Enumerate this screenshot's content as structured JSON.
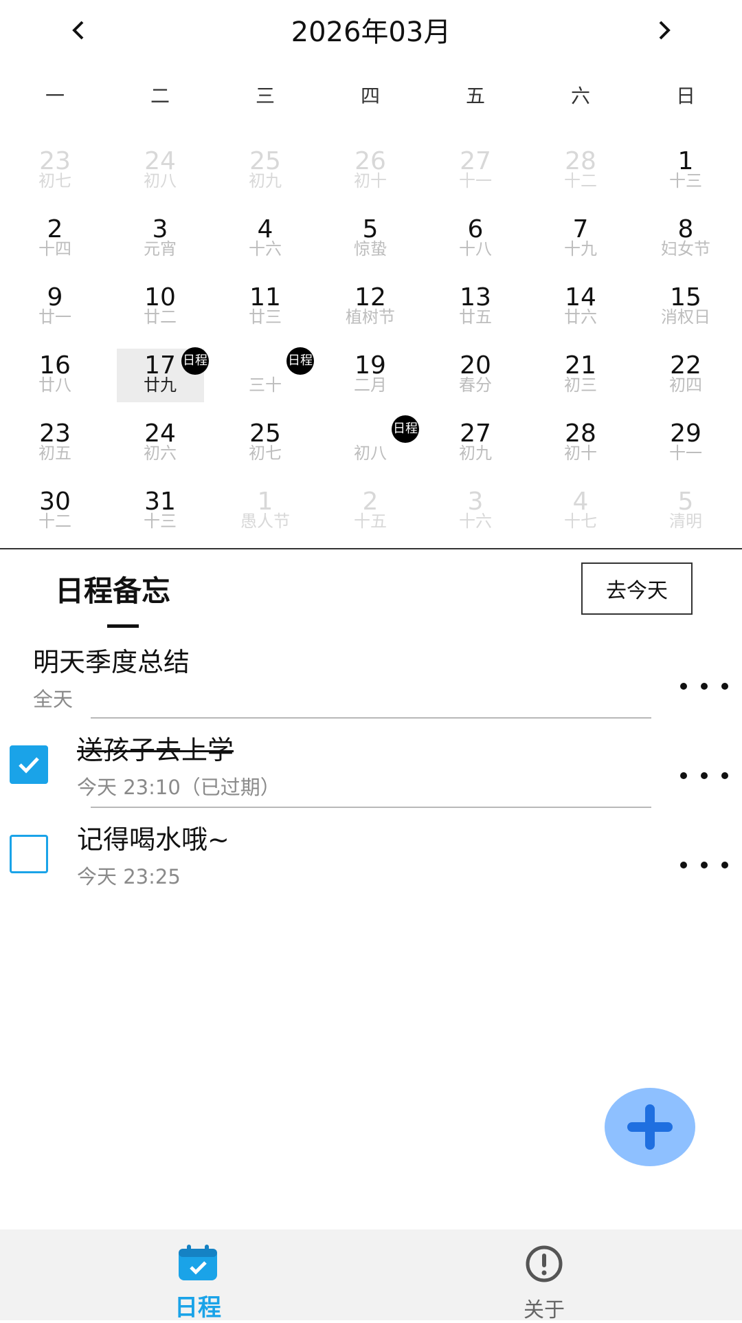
{
  "header": {
    "title": "2026年03月",
    "prev_icon": "chevron-left-icon",
    "next_icon": "chevron-right-icon"
  },
  "weekdays": [
    "一",
    "二",
    "三",
    "四",
    "五",
    "六",
    "日"
  ],
  "calendar": {
    "selected_day": "17",
    "badge_text": "日程",
    "days": [
      {
        "num": "23",
        "lunar": "初七",
        "other": true
      },
      {
        "num": "24",
        "lunar": "初八",
        "other": true
      },
      {
        "num": "25",
        "lunar": "初九",
        "other": true
      },
      {
        "num": "26",
        "lunar": "初十",
        "other": true
      },
      {
        "num": "27",
        "lunar": "十一",
        "other": true
      },
      {
        "num": "28",
        "lunar": "十二",
        "other": true
      },
      {
        "num": "1",
        "lunar": "十三",
        "other": false
      },
      {
        "num": "2",
        "lunar": "十四",
        "other": false
      },
      {
        "num": "3",
        "lunar": "元宵",
        "other": false
      },
      {
        "num": "4",
        "lunar": "十六",
        "other": false
      },
      {
        "num": "5",
        "lunar": "惊蛰",
        "other": false
      },
      {
        "num": "6",
        "lunar": "十八",
        "other": false
      },
      {
        "num": "7",
        "lunar": "十九",
        "other": false
      },
      {
        "num": "8",
        "lunar": "妇女节",
        "other": false
      },
      {
        "num": "9",
        "lunar": "廿一",
        "other": false
      },
      {
        "num": "10",
        "lunar": "廿二",
        "other": false
      },
      {
        "num": "11",
        "lunar": "廿三",
        "other": false
      },
      {
        "num": "12",
        "lunar": "植树节",
        "other": false
      },
      {
        "num": "13",
        "lunar": "廿五",
        "other": false
      },
      {
        "num": "14",
        "lunar": "廿六",
        "other": false
      },
      {
        "num": "15",
        "lunar": "消权日",
        "other": false
      },
      {
        "num": "16",
        "lunar": "廿八",
        "other": false
      },
      {
        "num": "17",
        "lunar": "廿九",
        "other": false,
        "selected": true,
        "badge": true
      },
      {
        "num": "",
        "lunar": "三十",
        "other": false,
        "badge": true
      },
      {
        "num": "19",
        "lunar": "二月",
        "other": false
      },
      {
        "num": "20",
        "lunar": "春分",
        "other": false
      },
      {
        "num": "21",
        "lunar": "初三",
        "other": false
      },
      {
        "num": "22",
        "lunar": "初四",
        "other": false
      },
      {
        "num": "23",
        "lunar": "初五",
        "other": false
      },
      {
        "num": "24",
        "lunar": "初六",
        "other": false
      },
      {
        "num": "25",
        "lunar": "初七",
        "other": false
      },
      {
        "num": "",
        "lunar": "初八",
        "other": false,
        "badge": true
      },
      {
        "num": "27",
        "lunar": "初九",
        "other": false
      },
      {
        "num": "28",
        "lunar": "初十",
        "other": false
      },
      {
        "num": "29",
        "lunar": "十一",
        "other": false
      },
      {
        "num": "30",
        "lunar": "十二",
        "other": false
      },
      {
        "num": "31",
        "lunar": "十三",
        "other": false
      },
      {
        "num": "1",
        "lunar": "愚人节",
        "other": true
      },
      {
        "num": "2",
        "lunar": "十五",
        "other": true
      },
      {
        "num": "3",
        "lunar": "十六",
        "other": true
      },
      {
        "num": "4",
        "lunar": "十七",
        "other": true
      },
      {
        "num": "5",
        "lunar": "清明",
        "other": true
      }
    ]
  },
  "schedule": {
    "section_title": "日程备忘",
    "today_button": "去今天",
    "items": [
      {
        "title": "明天季度总结",
        "subtitle": "全天",
        "checkbox": null,
        "done": false
      },
      {
        "title": "送孩子去上学",
        "subtitle": "今天 23:10（已过期）",
        "checkbox": true,
        "done": true
      },
      {
        "title": "记得喝水哦~",
        "subtitle": "今天 23:25",
        "checkbox": false,
        "done": false
      }
    ]
  },
  "fab": {
    "icon": "plus-icon"
  },
  "bottom_nav": [
    {
      "label": "日程",
      "icon": "calendar-check-icon",
      "active": true
    },
    {
      "label": "关于",
      "icon": "info-circle-icon",
      "active": false
    }
  ],
  "colors": {
    "accent": "#1aa3e8",
    "fab": "#8ec0ff",
    "fab_plus": "#1f6fe0",
    "badge": "#000000"
  }
}
